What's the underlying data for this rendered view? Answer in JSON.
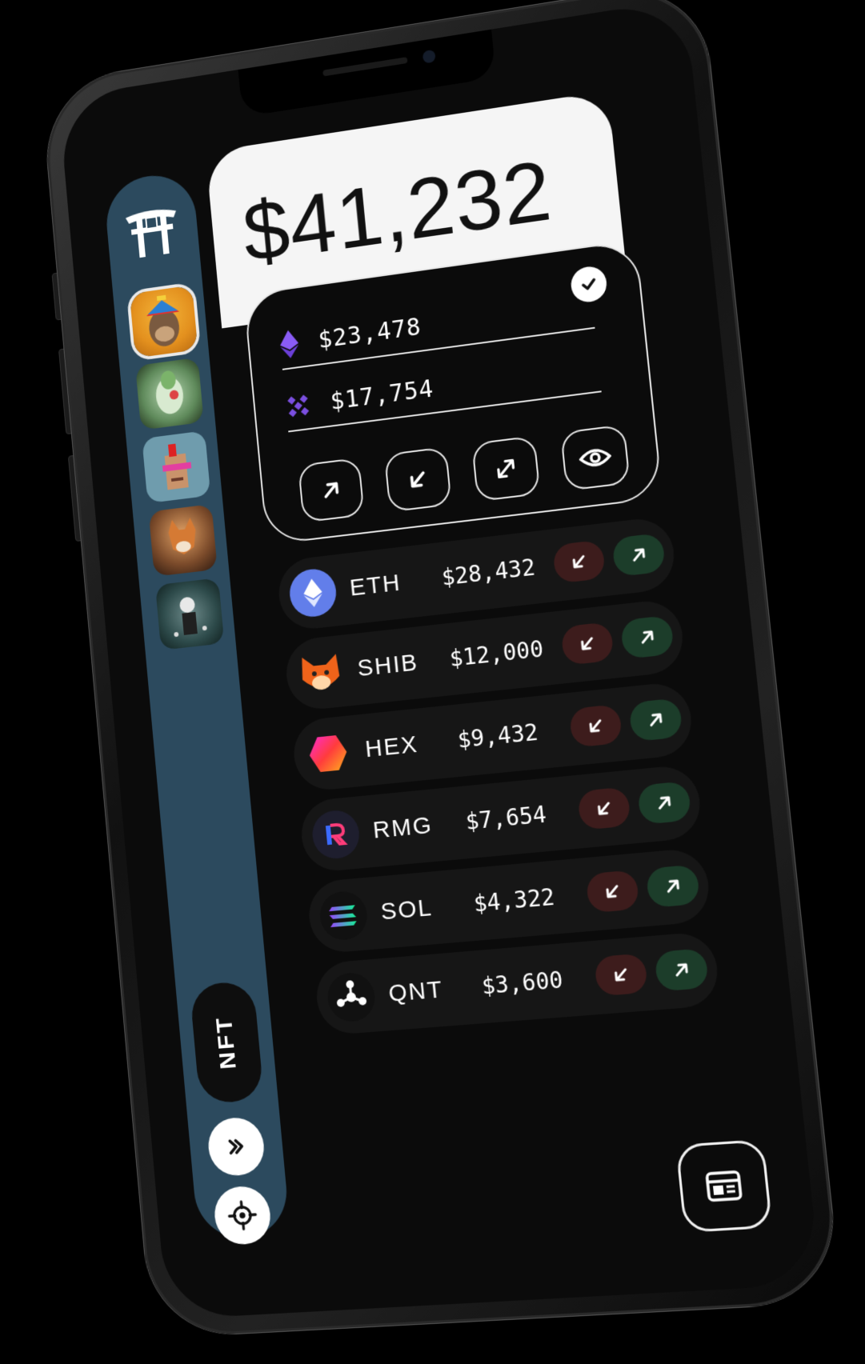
{
  "balance": {
    "total": "$41,232"
  },
  "wallets": [
    {
      "network": "ethereum",
      "icon": "ethereum-icon",
      "amount": "$23,478"
    },
    {
      "network": "binance",
      "icon": "binance-icon",
      "amount": "$17,754"
    }
  ],
  "wallet_actions": [
    {
      "name": "send-button",
      "icon": "arrow-up-right-icon"
    },
    {
      "name": "receive-button",
      "icon": "arrow-down-left-icon"
    },
    {
      "name": "swap-button",
      "icon": "expand-arrows-icon"
    },
    {
      "name": "view-button",
      "icon": "eye-icon"
    }
  ],
  "tokens": [
    {
      "symbol": "ETH",
      "value": "$28,432",
      "icon": "eth-icon",
      "color": "#627eea"
    },
    {
      "symbol": "SHIB",
      "value": "$12,000",
      "icon": "shib-icon",
      "color": "#f0631a"
    },
    {
      "symbol": "HEX",
      "value": "$9,432",
      "icon": "hex-icon",
      "color": "#ff3c7a"
    },
    {
      "symbol": "RMG",
      "value": "$7,654",
      "icon": "rmg-icon",
      "color": "#1e1e2e"
    },
    {
      "symbol": "SOL",
      "value": "$4,322",
      "icon": "sol-icon",
      "color": "#14f195"
    },
    {
      "symbol": "QNT",
      "value": "$3,600",
      "icon": "qnt-icon",
      "color": "#111111"
    }
  ],
  "sidebar": {
    "nft_label": "NFT",
    "avatars": [
      "ape-avatar",
      "green-character-avatar",
      "pixel-punk-avatar",
      "fox-avatar",
      "astronaut-avatar"
    ],
    "forward_icon": "double-chevron-right-icon",
    "target_icon": "crosshair-icon"
  },
  "colors": {
    "sidebar": "#2c4a5e",
    "receive": "#3d1c1c",
    "send": "#1c3d2a",
    "card": "#f5f5f5"
  }
}
